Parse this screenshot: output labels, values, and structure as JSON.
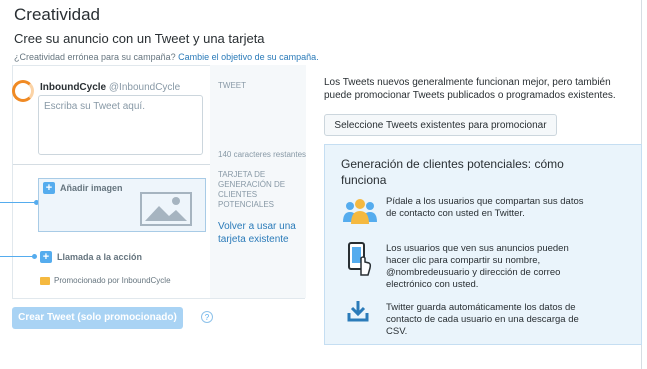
{
  "header": {
    "title": "Creatividad",
    "subtitle": "Cree su anuncio con un Tweet y una tarjeta",
    "question": "¿Creatividad errónea para su campaña?",
    "change_link": "Cambie el objetivo de su campaña."
  },
  "composer": {
    "account_name": "InboundCycle",
    "account_handle": "@InboundCycle",
    "placeholder": "Escriba su Tweet aquí.",
    "tweet_label": "TWEET",
    "char_count": "140 caracteres restantes",
    "card_label": "TARJETA DE GENERACIÓN DE CLIENTES POTENCIALES",
    "reuse_link": "Volver a usar una tarjeta existente",
    "add_image": "Añadir imagen",
    "call_to_action": "Llamada a la acción",
    "promoted_by": "Promocionado por InboundCycle",
    "create_button": "Crear Tweet (solo promocionado)",
    "help": "?"
  },
  "side": {
    "info": "Los Tweets nuevos generalmente funcionan mejor, pero también puede promocionar Tweets publicados o programados existentes.",
    "select_button": "Seleccione Tweets existentes para promocionar"
  },
  "leadgen": {
    "title": "Generación de clientes potenciales: cómo funciona",
    "steps": [
      {
        "icon": "people-icon",
        "text": "Pídale a los usuarios que compartan sus datos de contacto con usted en Twitter."
      },
      {
        "icon": "phone-icon",
        "text": "Los usuarios que ven sus anuncios pueden hacer clic para compartir su nombre, @nombredeusuario y dirección de correo electrónico con usted."
      },
      {
        "icon": "download-icon",
        "text": "Twitter guarda automáticamente los datos de contacto de cada usuario en una descarga de CSV."
      }
    ]
  },
  "colors": {
    "accent": "#55acee",
    "link": "#2b7bb9",
    "panel": "#eaf4fb",
    "avatar_ring": "#f08a24"
  }
}
